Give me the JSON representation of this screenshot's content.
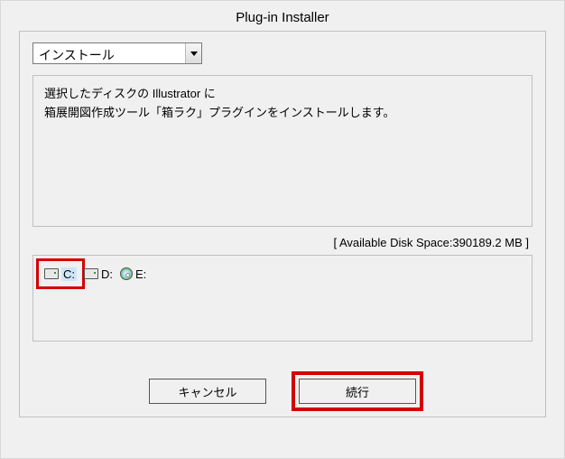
{
  "window": {
    "title": "Plug-in Installer"
  },
  "action_select": {
    "value": "インストール"
  },
  "description": {
    "line1": "選択したディスクの Illustrator に",
    "line2": "箱展開図作成ツール「箱ラク」プラグインをインストールします。"
  },
  "disk_space": {
    "label": "[ Available Disk Space:390189.2 MB ]"
  },
  "drives": [
    {
      "label": "C:",
      "type": "hdd",
      "selected": true
    },
    {
      "label": "D:",
      "type": "hdd",
      "selected": false
    },
    {
      "label": "E:",
      "type": "cd",
      "selected": false
    }
  ],
  "buttons": {
    "cancel": "キャンセル",
    "continue": "続行"
  }
}
